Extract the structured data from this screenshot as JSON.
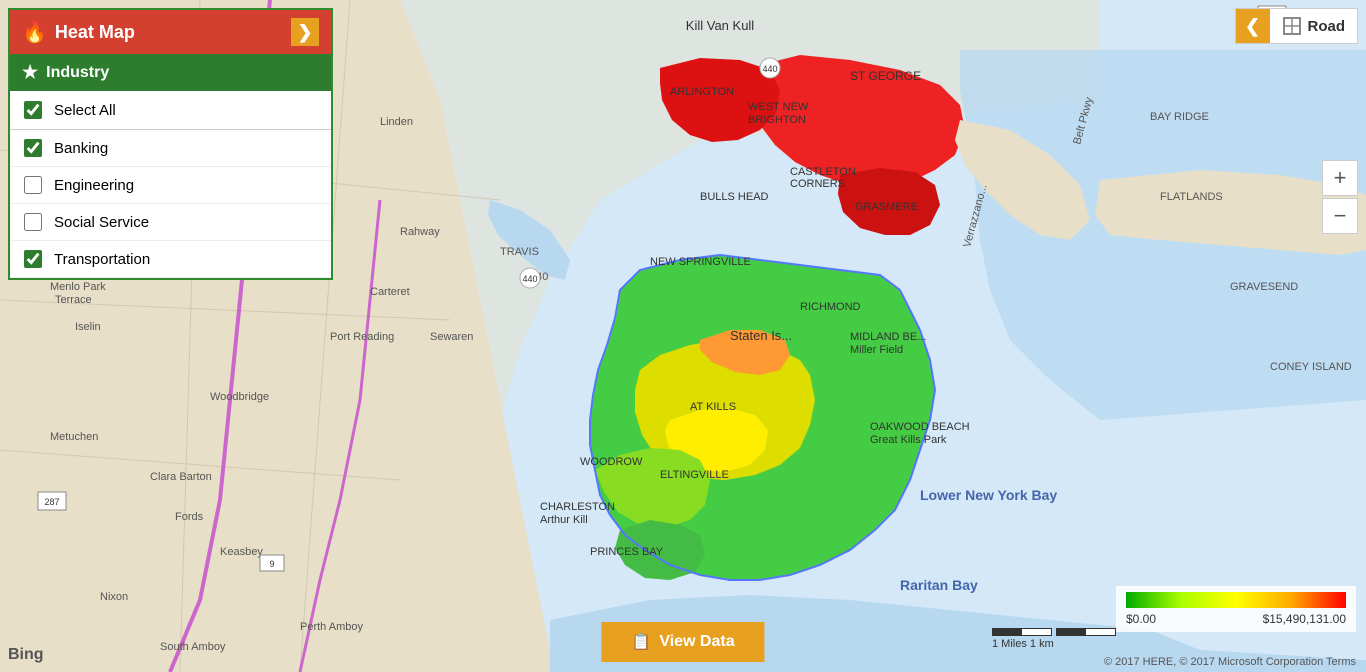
{
  "header": {
    "title": "Heat Map",
    "collapse_arrow": "❯"
  },
  "industry": {
    "label": "Industry",
    "items": [
      {
        "id": "select-all",
        "label": "Select All",
        "checked": true
      },
      {
        "id": "banking",
        "label": "Banking",
        "checked": true
      },
      {
        "id": "engineering",
        "label": "Engineering",
        "checked": false
      },
      {
        "id": "social-service",
        "label": "Social Service",
        "checked": false
      },
      {
        "id": "transportation",
        "label": "Transportation",
        "checked": true
      }
    ]
  },
  "road_button": {
    "label": "Road"
  },
  "zoom": {
    "plus": "+",
    "minus": "−"
  },
  "legend": {
    "min_label": "$0.00",
    "max_label": "$15,490,131.00"
  },
  "view_data_button": {
    "label": "View Data",
    "icon": "📋"
  },
  "copyright": {
    "text": "© 2017 HERE, © 2017 Microsoft Corporation  Terms"
  },
  "scale": {
    "text": "1 Miles    1 km"
  },
  "bing": {
    "text": "Bing"
  }
}
